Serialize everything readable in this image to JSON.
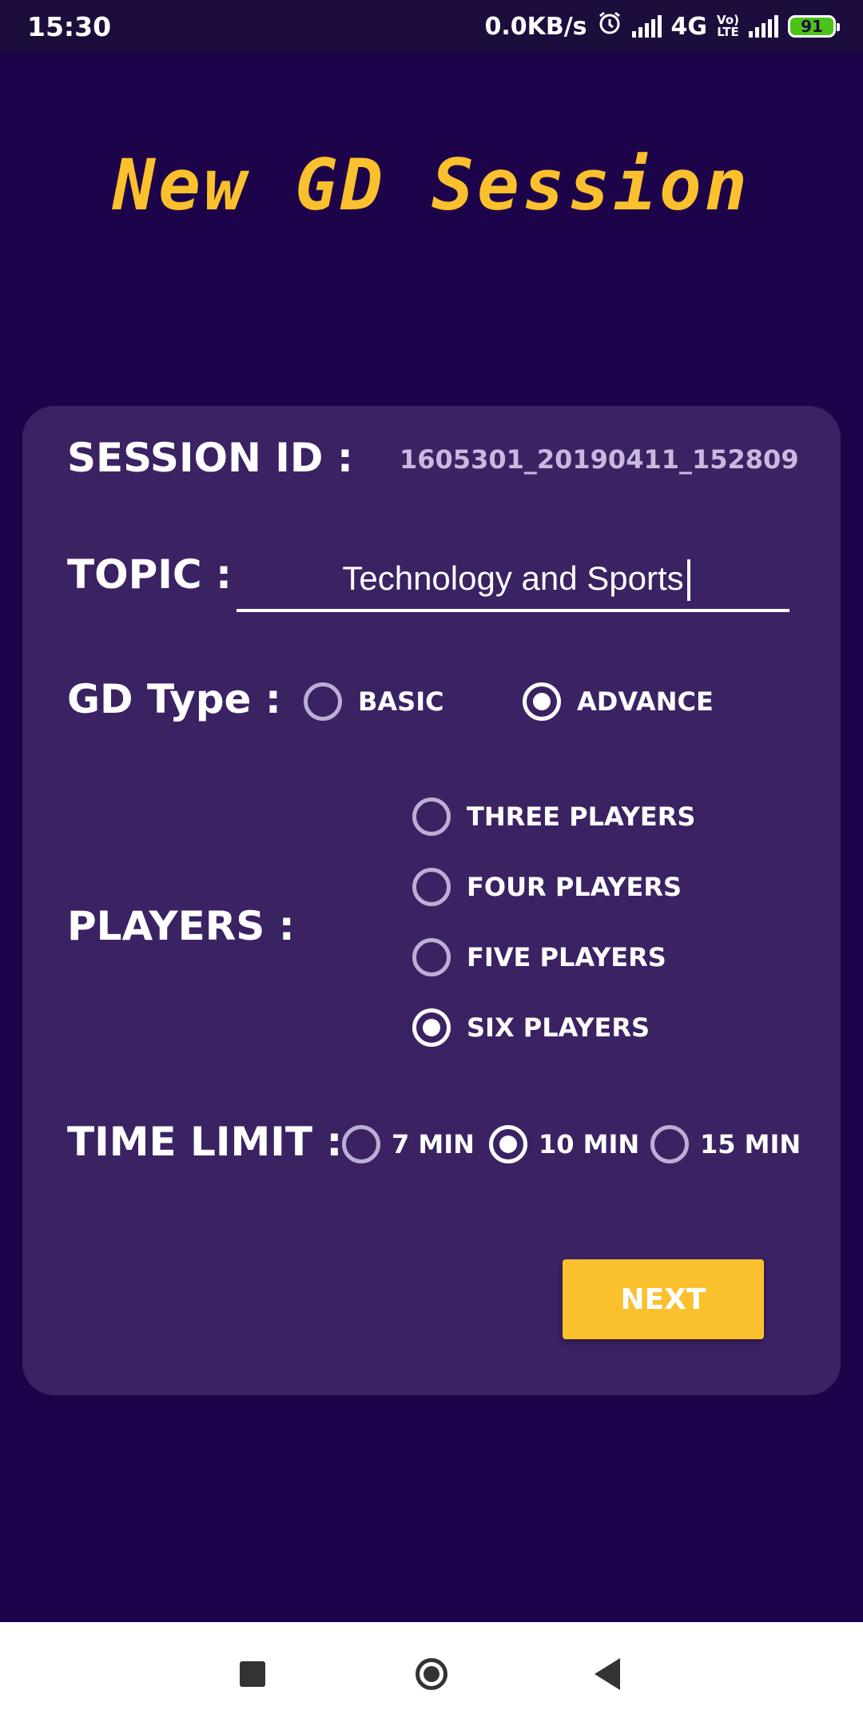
{
  "status_bar": {
    "time": "15:30",
    "network_speed": "0.0KB/s",
    "network_type": "4G",
    "volte_label_top": "Vo)",
    "volte_label_bottom": "LTE",
    "battery": "91",
    "icons": [
      "alarm-icon",
      "signal-icon",
      "signal-icon",
      "battery-icon"
    ]
  },
  "title": "New GD Session",
  "form": {
    "session_id_label": "SESSION ID :",
    "session_id_value": "1605301_20190411_152809",
    "topic_label": "TOPIC :",
    "topic_value": "Technology and Sports",
    "gd_type_label": "GD Type :",
    "gd_type_options": [
      {
        "label": "BASIC",
        "checked": false
      },
      {
        "label": "ADVANCE",
        "checked": true
      }
    ],
    "players_label": "PLAYERS :",
    "players_options": [
      {
        "label": "THREE PLAYERS",
        "checked": false
      },
      {
        "label": "FOUR PLAYERS",
        "checked": false
      },
      {
        "label": "FIVE PLAYERS",
        "checked": false
      },
      {
        "label": "SIX PLAYERS",
        "checked": true
      }
    ],
    "time_limit_label": "TIME LIMIT :",
    "time_limit_options": [
      {
        "label": "7 MIN",
        "checked": false
      },
      {
        "label": "10 MIN",
        "checked": true
      },
      {
        "label": "15 MIN",
        "checked": false
      }
    ],
    "next_label": "NEXT"
  },
  "colors": {
    "background": "#1d0349",
    "card": "#3b2263",
    "accent": "#fbc02d"
  }
}
